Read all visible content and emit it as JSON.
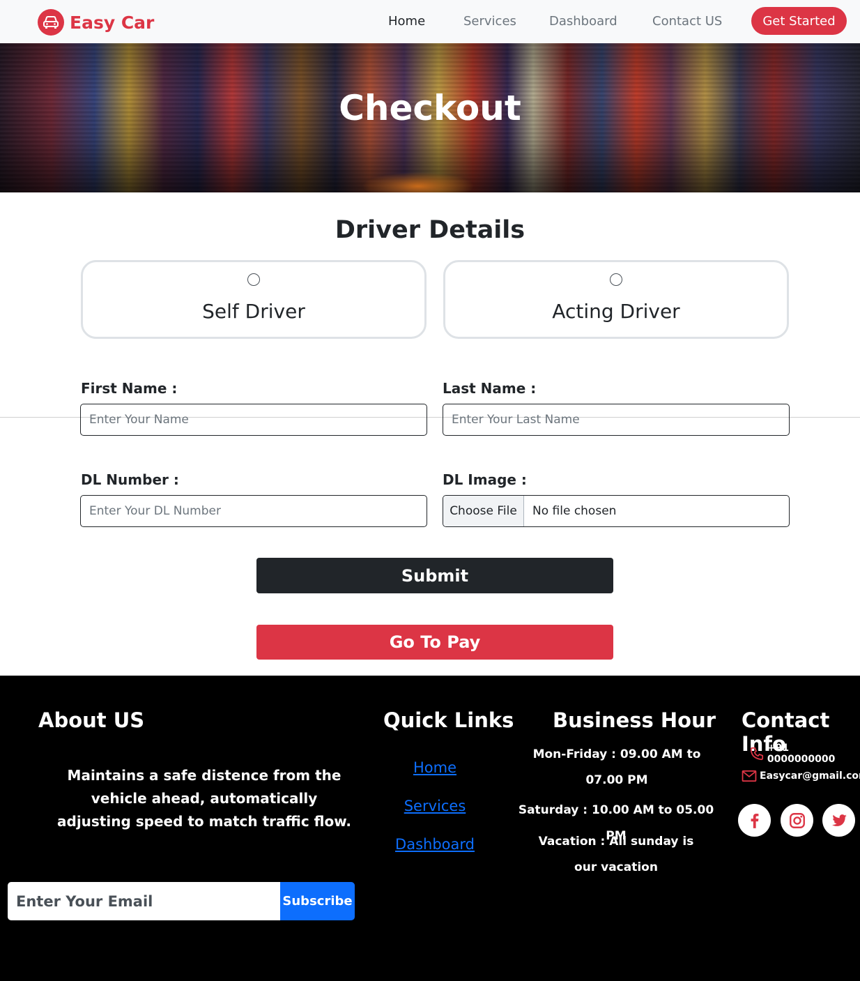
{
  "brand": {
    "name": "Easy Car",
    "logo_icon": "car-icon"
  },
  "nav": {
    "items": [
      {
        "label": "Home",
        "active": true
      },
      {
        "label": "Services",
        "active": false
      },
      {
        "label": "Dashboard",
        "active": false
      },
      {
        "label": "Contact US",
        "active": false
      }
    ],
    "cta_label": "Get Started"
  },
  "hero": {
    "title": "Checkout"
  },
  "driver": {
    "title": "Driver Details",
    "options": [
      {
        "label": "Self Driver",
        "selected": false
      },
      {
        "label": "Acting Driver",
        "selected": false
      }
    ]
  },
  "form": {
    "first_name": {
      "label": "First Name :",
      "placeholder": "Enter Your Name",
      "value": ""
    },
    "last_name": {
      "label": "Last Name :",
      "placeholder": "Enter Your Last Name",
      "value": ""
    },
    "dl_number": {
      "label": "DL Number :",
      "placeholder": "Enter Your DL Number",
      "value": ""
    },
    "dl_image": {
      "label": "DL Image :",
      "button_label": "Choose File",
      "file_status": "No file chosen"
    },
    "submit_label": "Submit",
    "pay_label": "Go To Pay"
  },
  "footer": {
    "about": {
      "heading": "About US",
      "text": "Maintains a safe distence from the vehicle ahead, automatically adjusting speed to match traffic flow."
    },
    "subscribe": {
      "placeholder": "Enter Your Email",
      "button_label": "Subscribe"
    },
    "quick_links": {
      "heading": "Quick Links",
      "links": [
        "Home",
        "Services",
        "Dashboard"
      ]
    },
    "business": {
      "heading": "Business Hour",
      "weekday": "Mon-Friday : 09.00 AM to 07.00 PM",
      "saturday": "Saturday : 10.00 AM to 05.00 PM",
      "vacation": "Vacation : All sunday is our vacation"
    },
    "contact": {
      "heading": "Contact Info",
      "phone": "+91 0000000000",
      "email": "Easycar@gmail.com",
      "social": [
        "facebook-icon",
        "instagram-icon",
        "twitter-icon"
      ]
    }
  },
  "colors": {
    "brand_red": "#dc3545",
    "dark": "#212529",
    "link_blue": "#0d6efd",
    "footer_bg": "#000000"
  }
}
